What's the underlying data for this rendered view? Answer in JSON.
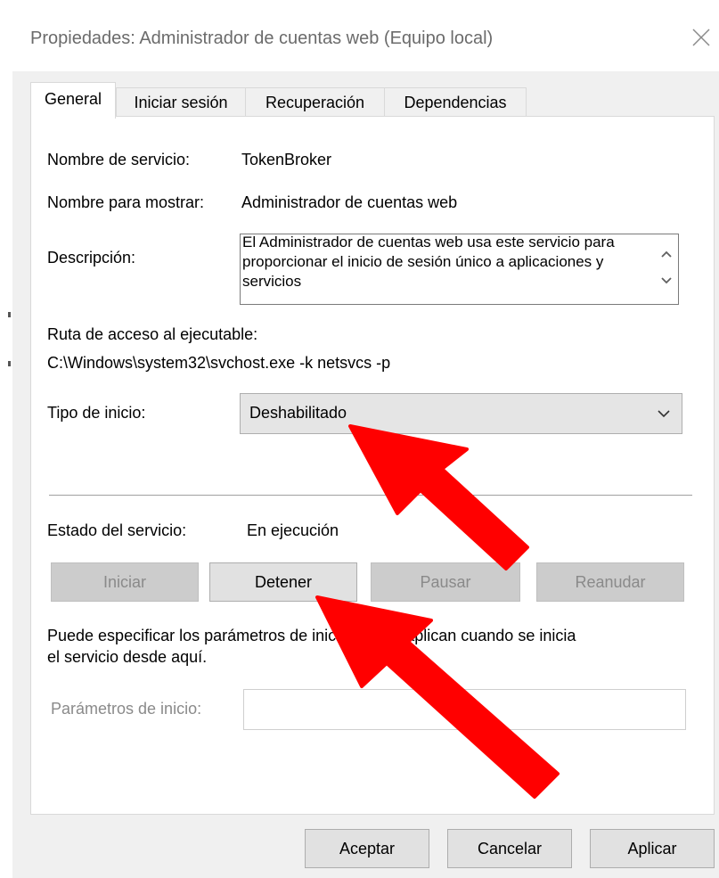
{
  "window": {
    "title": "Propiedades: Administrador de cuentas web (Equipo local)"
  },
  "tabs": [
    {
      "label": "General",
      "active": true
    },
    {
      "label": "Iniciar sesión",
      "active": false
    },
    {
      "label": "Recuperación",
      "active": false
    },
    {
      "label": "Dependencias",
      "active": false
    }
  ],
  "general": {
    "service_name_label": "Nombre de servicio:",
    "service_name_value": "TokenBroker",
    "display_name_label": "Nombre para mostrar:",
    "display_name_value": "Administrador de cuentas web",
    "description_label": "Descripción:",
    "description_value": "El Administrador de cuentas web usa este servicio para proporcionar el inicio de sesión único a aplicaciones y servicios",
    "path_label": "Ruta de acceso al ejecutable:",
    "path_value": "C:\\Windows\\system32\\svchost.exe -k netsvcs -p",
    "startup_type_label": "Tipo de inicio:",
    "startup_type_value": "Deshabilitado",
    "service_status_label": "Estado del servicio:",
    "service_status_value": "En ejecución",
    "buttons": {
      "start": "Iniciar",
      "stop": "Detener",
      "pause": "Pausar",
      "resume": "Reanudar"
    },
    "params_hint": "Puede especificar los parámetros de inicio que se aplican cuando se inicia el servicio desde aquí.",
    "params_hint_line1": "Puede especificar los parámetros de inicio que se aplican cuando se inicia",
    "params_hint_line2": "el servicio desde aquí.",
    "start_params_label": "Parámetros de inicio:",
    "start_params_value": ""
  },
  "footer": {
    "ok": "Aceptar",
    "cancel": "Cancelar",
    "apply": "Aplicar"
  },
  "colors": {
    "annotation_arrow": "#ff0000",
    "disabled_button": "#cccccc",
    "combo_background": "#e5e5e5"
  },
  "icons": [
    "close-icon",
    "scroll-up-icon",
    "scroll-down-icon",
    "chevron-down-icon",
    "annotation-arrow-icon"
  ]
}
